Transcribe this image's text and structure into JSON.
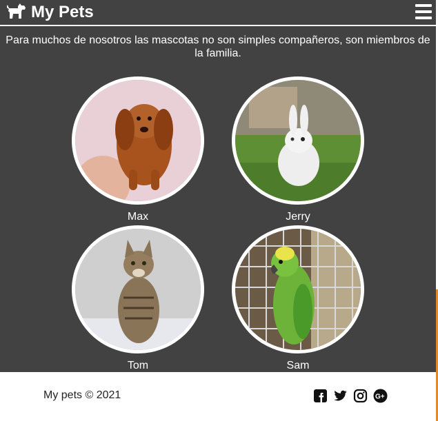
{
  "header": {
    "title": "My Pets",
    "logo_icon": "dog-icon",
    "menu_icon": "hamburger-menu-icon"
  },
  "intro": {
    "text": "Para muchos de nosotros las mascotas no son simples compañeros, son miembros de la familia."
  },
  "pets": [
    {
      "name": "Max",
      "photo": "dachshund-puppy-photo"
    },
    {
      "name": "Jerry",
      "photo": "white-rabbit-photo"
    },
    {
      "name": "Tom",
      "photo": "tabby-cat-photo"
    },
    {
      "name": "Sam",
      "photo": "green-parrot-photo"
    }
  ],
  "footer": {
    "copyright": "My pets © 2021",
    "social": [
      "facebook-icon",
      "twitter-icon",
      "instagram-icon",
      "google-plus-icon"
    ]
  },
  "colors": {
    "background": "#424242",
    "text": "#ffffff",
    "footer_background": "#ffffff",
    "footer_text": "#222222",
    "accent_edge": "#e08a2e"
  }
}
